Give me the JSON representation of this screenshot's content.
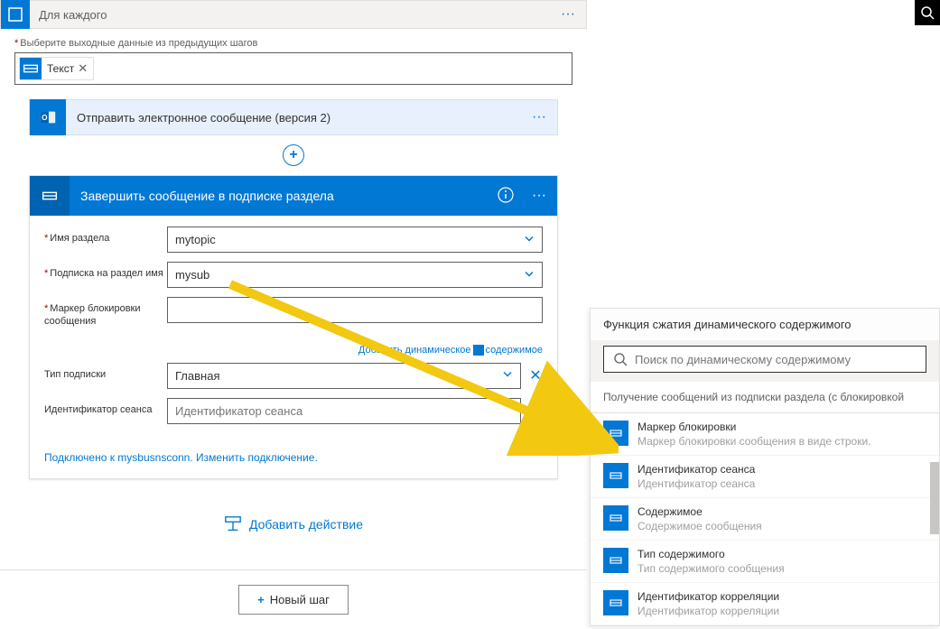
{
  "foreach": {
    "title": "Для каждого"
  },
  "prev_output": {
    "label": "Выберите выходные данные из предыдущих шагов",
    "token": "Текст"
  },
  "outlook": {
    "title": "Отправить электронное сообщение (версия 2)"
  },
  "sb": {
    "title": "Завершить сообщение в подписке раздела",
    "fields": {
      "topic_label": "Имя раздела",
      "topic_value": "mytopic",
      "sub_label": "Подписка на раздел имя",
      "sub_value": "mysub",
      "lock_label": "Маркер блокировки сообщения",
      "lock_value": "",
      "subtype_label": "Тип подписки",
      "subtype_value": "Главная",
      "session_label": "Идентификатор сеанса",
      "session_placeholder": "Идентификатор сеанса"
    },
    "dynamic_link": "Добавить динамическое",
    "dynamic_link2": "содержимое",
    "connection": "Подключено к mysbusnsconn. Изменить подключение."
  },
  "add_action": "Добавить действие",
  "new_step": "Новый шаг",
  "dc": {
    "header": "Функция сжатия динамического содержимого",
    "search_placeholder": "Поиск по динамическому содержимому",
    "section": "Получение сообщений из подписки раздела (с блокировкой",
    "items": [
      {
        "title": "Маркер блокировки",
        "desc": "Маркер блокировки сообщения в виде строки."
      },
      {
        "title": "Идентификатор сеанса",
        "desc": "Идентификатор сеанса"
      },
      {
        "title": "Содержимое",
        "desc": "Содержимое сообщения"
      },
      {
        "title": "Тип содержимого",
        "desc": "Тип содержимого сообщения"
      },
      {
        "title": "Идентификатор корреляции",
        "desc": "Идентификатор корреляции"
      }
    ]
  }
}
